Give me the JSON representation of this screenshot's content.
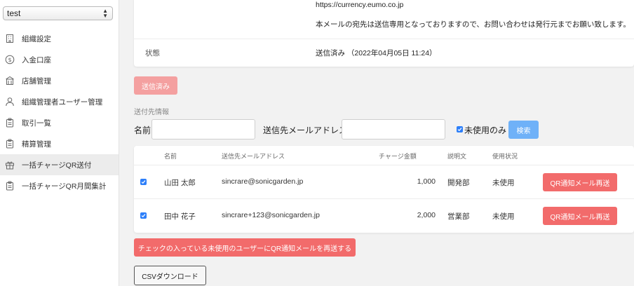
{
  "sidebar": {
    "org_select": "test",
    "items": [
      {
        "label": "組織設定",
        "icon": "building-icon",
        "active": false
      },
      {
        "label": "入金口座",
        "icon": "dollar-icon",
        "active": false
      },
      {
        "label": "店舗管理",
        "icon": "store-icon",
        "active": false
      },
      {
        "label": "組織管理者ユーザー管理",
        "icon": "users-icon",
        "active": false
      },
      {
        "label": "取引一覧",
        "icon": "clipboard-icon",
        "active": false
      },
      {
        "label": "精算管理",
        "icon": "clipboard-icon",
        "active": false
      },
      {
        "label": "一括チャージQR送付",
        "icon": "gift-icon",
        "active": true
      },
      {
        "label": "一括チャージQR月間集計",
        "icon": "clipboard-icon",
        "active": false
      }
    ]
  },
  "detail": {
    "url": "https://currency.eumo.co.jp",
    "note": "本メールの宛先は送信専用となっておりますので、お問い合わせは発行元までお願い致します。",
    "status_label": "状態",
    "status_value": "送信済み （2022年04月05日 11:24）"
  },
  "sent_button": "送信済み",
  "recipients": {
    "section_title": "送付先情報",
    "filter": {
      "name_label": "名前",
      "name_value": "",
      "email_label": "送信先メールアドレス",
      "email_value": "",
      "unused_only_label": "未使用のみ",
      "unused_only_checked": true,
      "search_button": "検索"
    },
    "columns": [
      "名前",
      "送信先メールアドレス",
      "チャージ金額",
      "説明文",
      "使用状況"
    ],
    "rows": [
      {
        "checked": true,
        "name": "山田 太郎",
        "email": "sincrare@sonicgarden.jp",
        "amount": "1,000",
        "description": "開発部",
        "usage": "未使用",
        "action": "QR通知メール再送"
      },
      {
        "checked": true,
        "name": "田中 花子",
        "email": "sincrare+123@sonicgarden.jp",
        "amount": "2,000",
        "description": "営業部",
        "usage": "未使用",
        "action": "QR通知メール再送"
      }
    ],
    "bulk_resend_button": "チェックの入っている未使用のユーザーにQR通知メールを再送する",
    "csv_button": "CSVダウンロード"
  },
  "colors": {
    "accent_red": "#f26b6b",
    "disabled_red": "#f4a0a0",
    "accent_blue": "#6fb1f8",
    "checkbox_blue": "#2d7ff9"
  }
}
